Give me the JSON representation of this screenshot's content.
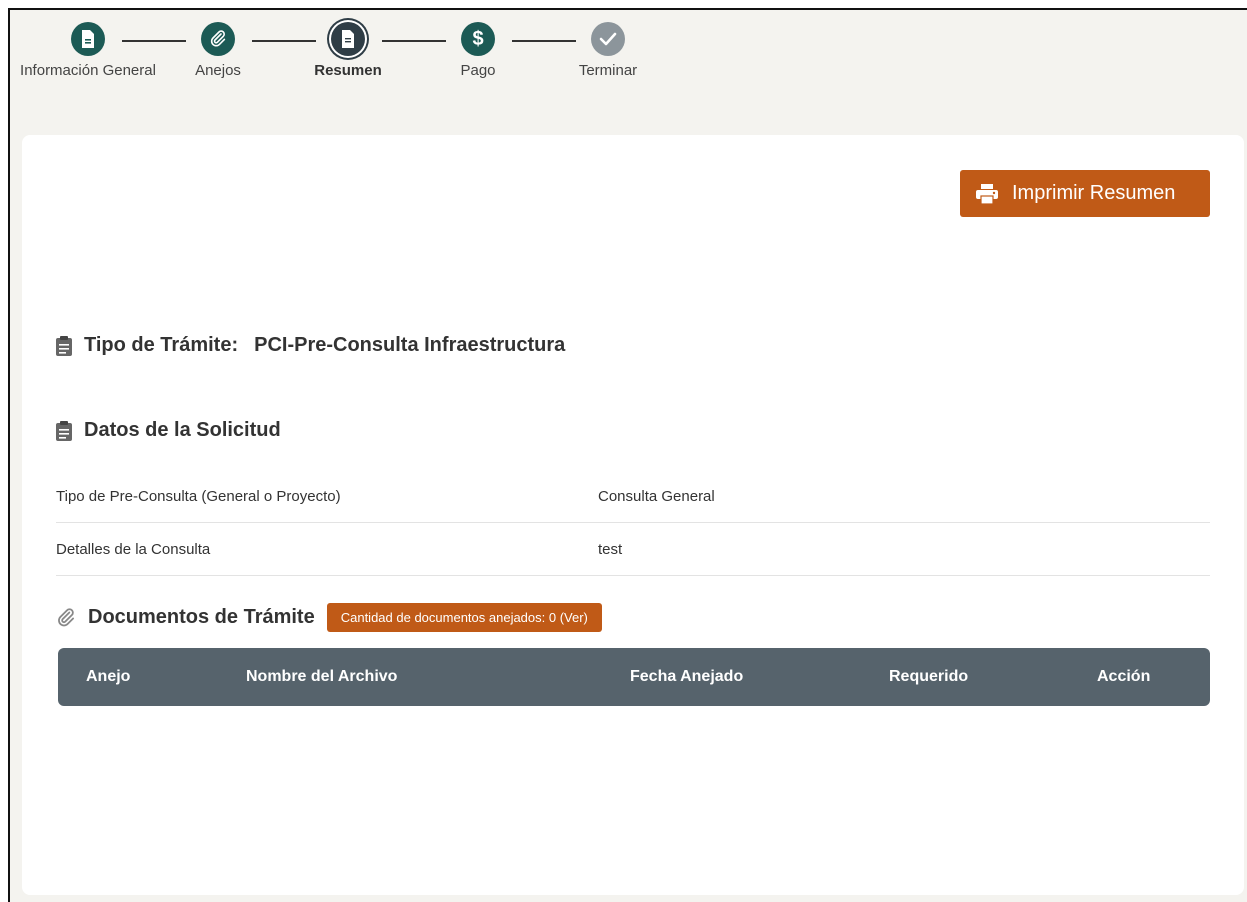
{
  "stepper": {
    "steps": [
      {
        "label": "Información General",
        "icon": "document-icon",
        "state": "complete"
      },
      {
        "label": "Anejos",
        "icon": "paperclip-icon",
        "state": "complete"
      },
      {
        "label": "Resumen",
        "icon": "summary-icon",
        "state": "active"
      },
      {
        "label": "Pago",
        "icon": "dollar-icon",
        "state": "complete"
      },
      {
        "label": "Terminar",
        "icon": "check-icon",
        "state": "pending"
      }
    ]
  },
  "toolbar": {
    "print_label": "Imprimir Resumen"
  },
  "tipo": {
    "label": "Tipo de Trámite:",
    "value": "PCI-Pre-Consulta Infraestructura"
  },
  "datos": {
    "title": "Datos de la Solicitud",
    "rows": [
      {
        "key": "Tipo de Pre-Consulta (General o Proyecto)",
        "value": "Consulta General"
      },
      {
        "key": "Detalles de la Consulta",
        "value": "test"
      }
    ]
  },
  "documentos": {
    "title": "Documentos de Trámite",
    "badge": "Cantidad de documentos anejados: 0 (Ver)",
    "columns": [
      "Anejo",
      "Nombre del Archivo",
      "Fecha Anejado",
      "Requerido",
      "Acción"
    ]
  },
  "colors": {
    "accent": "#c05a17",
    "teal": "#1c5a55",
    "header": "#56636c"
  }
}
